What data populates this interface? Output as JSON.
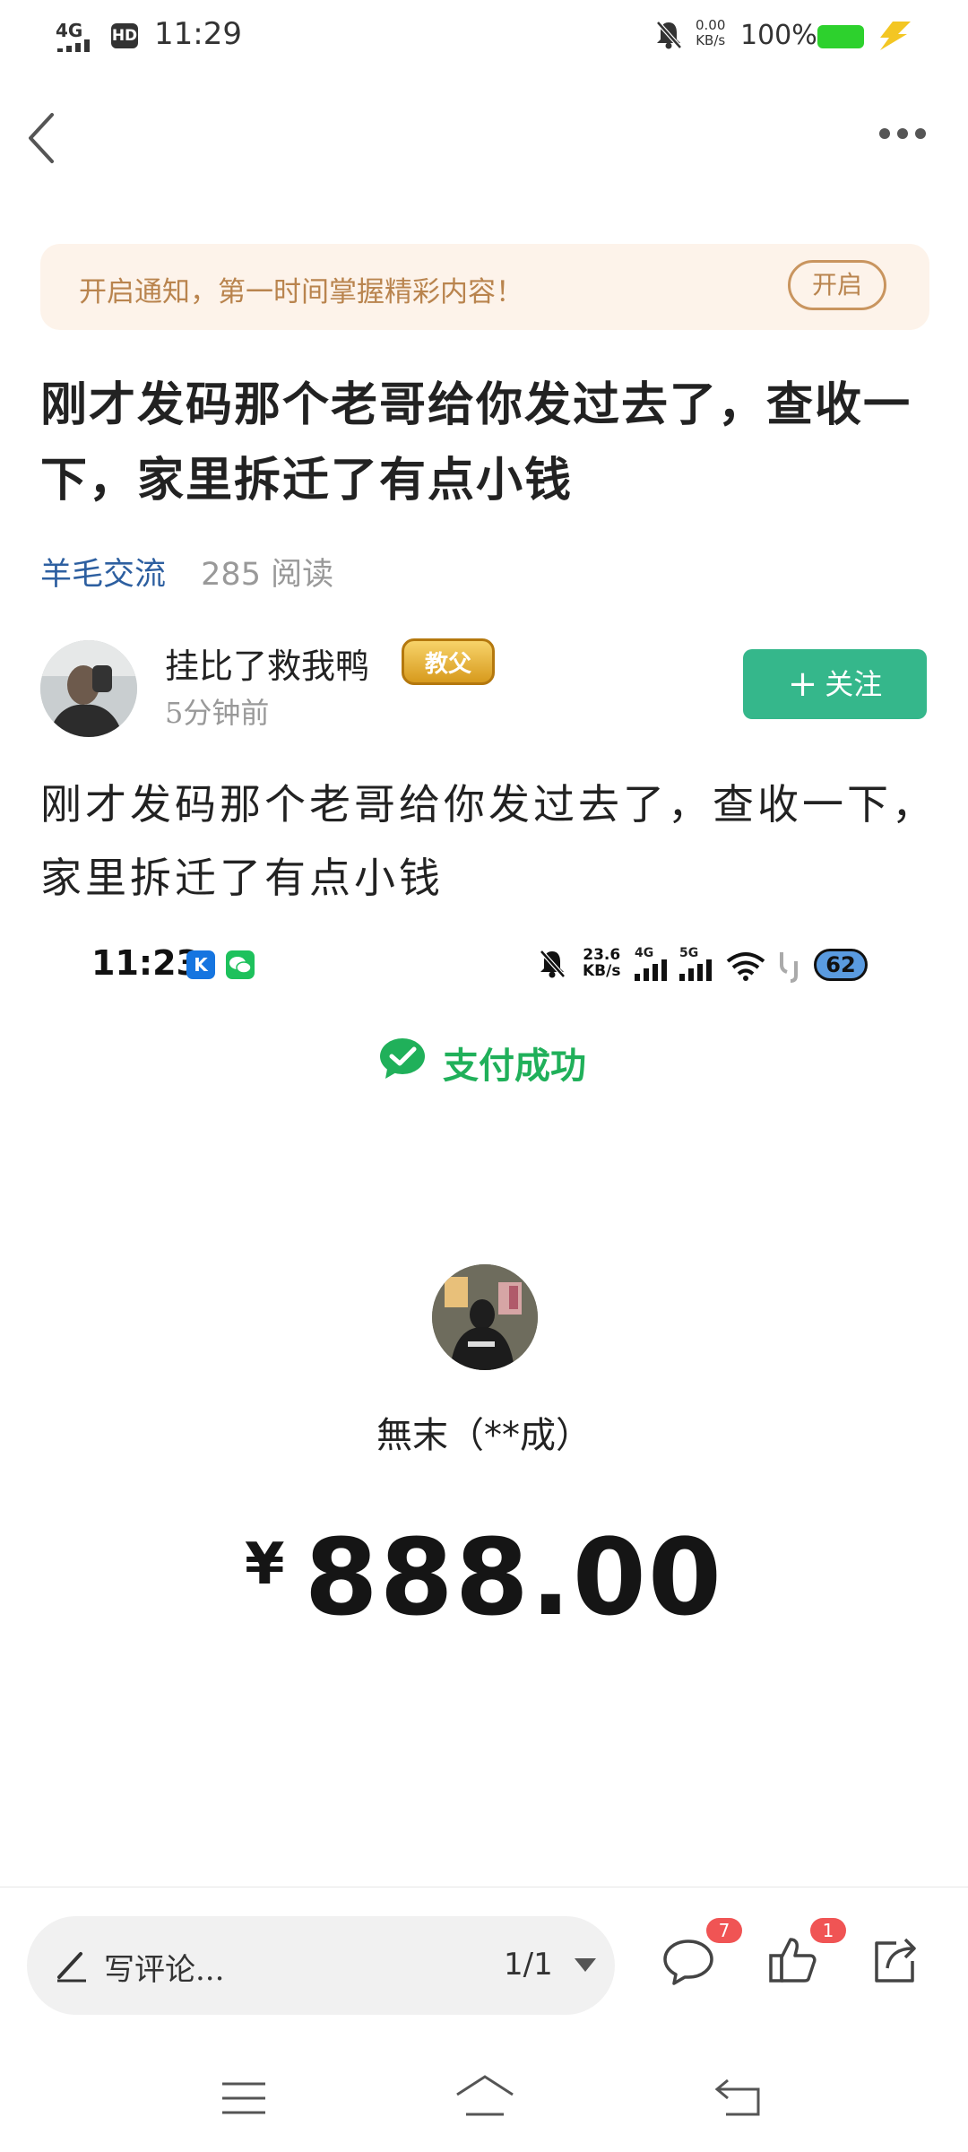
{
  "status_bar": {
    "network": "4G",
    "hd": "HD",
    "time": "11:29",
    "speed_value": "0.00",
    "speed_unit": "KB/s",
    "battery_percent": "100%"
  },
  "notice": {
    "text": "开启通知，第一时间掌握精彩内容！",
    "button_label": "开启"
  },
  "article": {
    "title": "刚才发码那个老哥给你发过去了，查收一下，家里拆迁了有点小钱",
    "category": "羊毛交流",
    "reads": "285 阅读",
    "author_name": "挂比了救我鸭",
    "author_badge": "教父",
    "post_time": "5分钟前",
    "follow_label": "关注",
    "body": "刚才发码那个老哥给你发过去了，查收一下，家里拆迁了有点小钱"
  },
  "embedded_screenshot": {
    "time": "11:23",
    "app1_letter": "K",
    "speed_value": "23.6",
    "speed_unit": "KB/s",
    "net1": "4G",
    "net2": "5G",
    "battery": "62",
    "pay_status": "支付成功",
    "payee_name": "無末（**成）",
    "currency": "¥",
    "amount": "888.00"
  },
  "bottom_bar": {
    "comment_placeholder": "写评论...",
    "page_indicator": "1/1",
    "comment_count": "7",
    "like_count": "1"
  },
  "colors": {
    "accent_green": "#35b78b",
    "pay_green": "#20b05a",
    "notice_bg": "#fdf3ea",
    "notice_text": "#b9844e",
    "category_blue": "#2d5fa0",
    "count_badge_red": "#f05454"
  },
  "icons": {
    "back": "chevron-left-icon",
    "more": "more-dots-icon",
    "mute": "bell-off-icon",
    "charging": "bolt-icon",
    "pay_success": "wechat-check-icon",
    "pen": "pen-icon",
    "comment": "comment-bubble-icon",
    "like": "thumbs-up-icon",
    "share": "share-icon"
  }
}
